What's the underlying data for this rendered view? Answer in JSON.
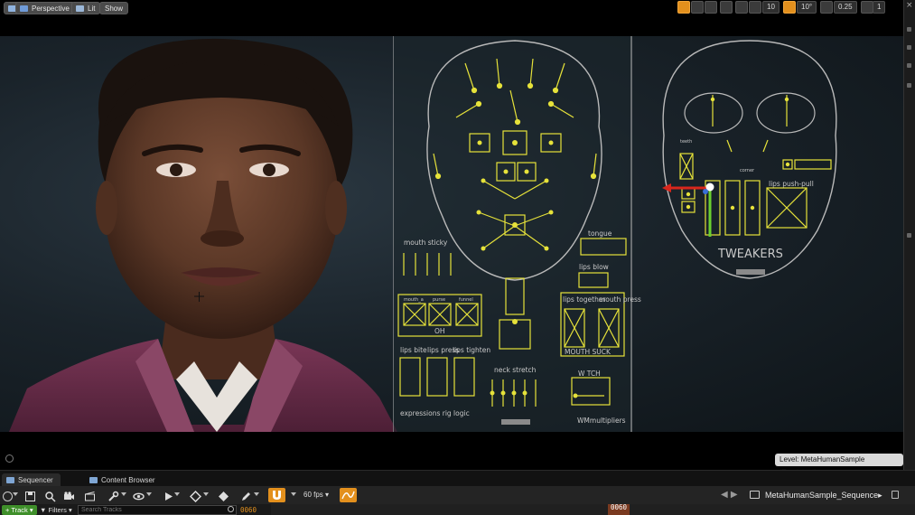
{
  "viewport": {
    "toolbar": {
      "perspective_label": "Perspective",
      "lit_label": "Lit",
      "show_label": "Show",
      "grid_snap_value": "10",
      "rotation_snap_value": "10°",
      "scale_snap_value": "0.25",
      "camera_speed_value": "1"
    },
    "rig": {
      "mouth_sticky": "mouth sticky",
      "oh": "OH",
      "label_mouth_a": "mouth_a",
      "label_purse": "purse",
      "label_funnel": "funnel",
      "lips_bite": "lips bite",
      "lips_press": "lips press",
      "lips_tighten": "lips tighten",
      "neck_stretch": "neck stretch",
      "expressions_rig_logic": "expressions rig logic",
      "tongue": "tongue",
      "lips_blow": "lips blow",
      "lips_together": "lips together",
      "mouth_press": "mouth press",
      "mouth_suck": "MOUTH SUCK",
      "w_tch": "W TCH",
      "wm_multipliers": "WMmultipliers",
      "tweakers": "TWEAKERS",
      "lips_push_pull": "lips push-pull",
      "corner_label": "corner",
      "teeth_label": "teeth"
    },
    "level_badge": "Level:  MetaHumanSample (Persistent)"
  },
  "bottom_tabs": {
    "sequencer": "Sequencer",
    "content_browser": "Content Browser"
  },
  "sequencer": {
    "fps_label": "60 fps",
    "sequence_name": "MetaHumanSample_Sequence",
    "track_button": "Track",
    "filters_button": "Filters",
    "search_placeholder": "Search Tracks",
    "current_frame": "0060",
    "playhead_frame": "0060"
  },
  "colors": {
    "accent": "#e3901d",
    "rig_yellow": "#e6e23a",
    "rig_line": "#b9b9b9",
    "gizmo_red": "#d8261c",
    "gizmo_green": "#6ad12f",
    "track_green": "#3f8f2a"
  }
}
